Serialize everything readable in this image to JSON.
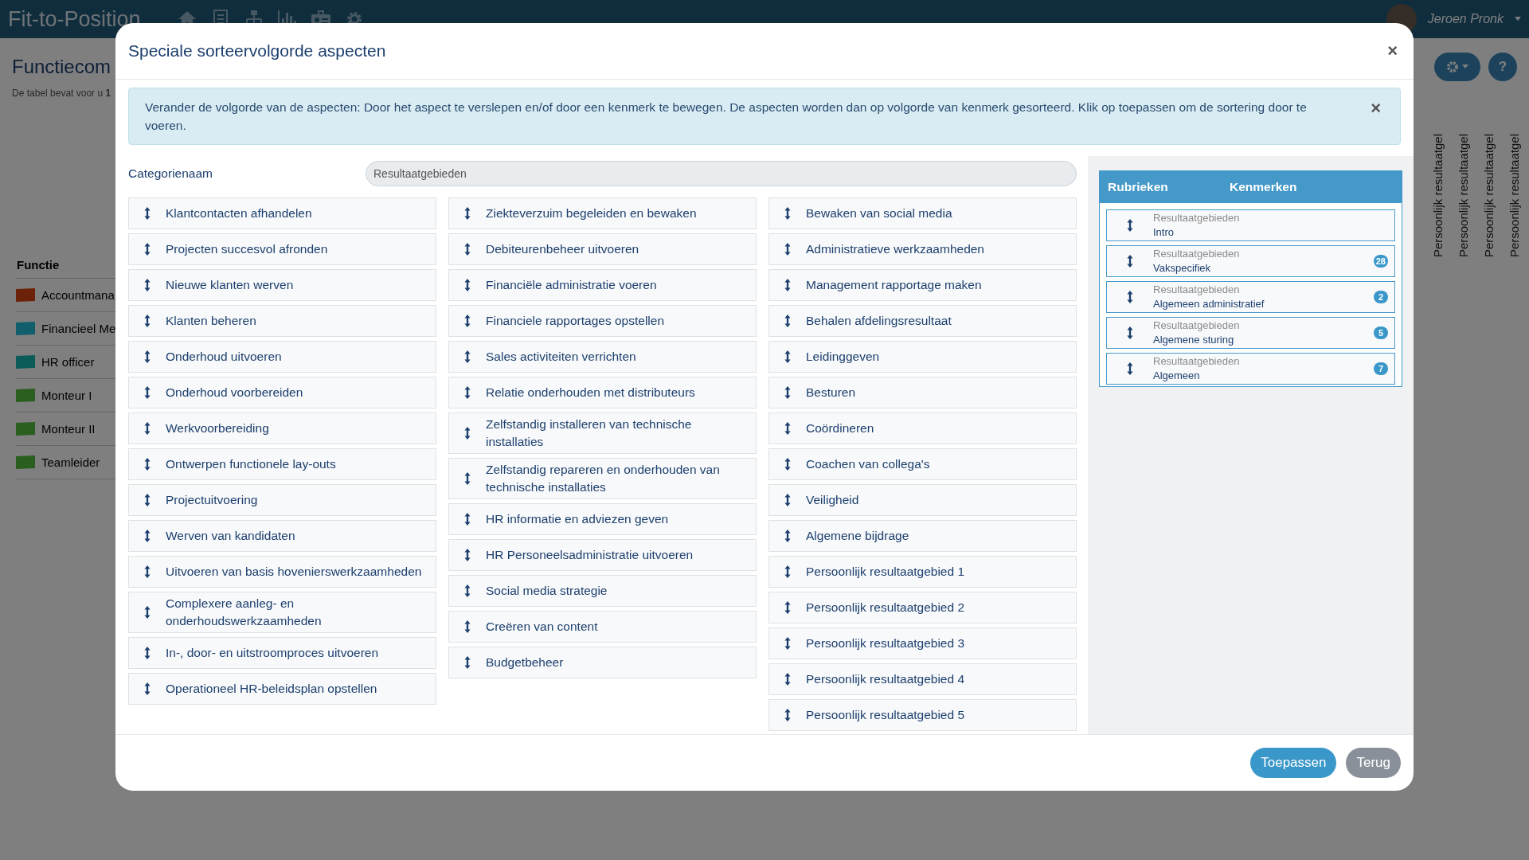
{
  "app": {
    "logo": "Fit-to-Position",
    "user": "Jeroen Pronk",
    "help": "?"
  },
  "page": {
    "title": "Functiecom",
    "summary": "De tabel bevat voor u **1**",
    "table": {
      "header": "Functie",
      "rows": [
        {
          "name": "Accountmana",
          "color": "#6b2208"
        },
        {
          "name": "Financieel Me",
          "color": "#115e6c"
        },
        {
          "name": "HR officer",
          "color": "#0b5c58"
        },
        {
          "name": "Monteur I",
          "color": "#2a5e1e"
        },
        {
          "name": "Monteur II",
          "color": "#2a5e1e"
        },
        {
          "name": "Teamleider",
          "color": "#2a5e1e"
        }
      ],
      "column_headers": [
        "Persoonlijk resultaatgel",
        "Persoonlijk resultaatgel",
        "Persoonlijk resultaatgel",
        "Persoonlijk resultaatgel"
      ]
    }
  },
  "modal": {
    "title": "Speciale sorteervolgorde aspecten",
    "close": "×",
    "alert": {
      "text": "Verander de volgorde van de aspecten: Door het aspect te verslepen en/of door een kenmerk te bewegen. De aspecten worden dan op volgorde van kenmerk gesorteerd. Klik op toepassen om de sortering door te voeren.",
      "close": "×"
    },
    "category": {
      "label": "Categorienaam",
      "value": "Resultaatgebieden"
    },
    "columns": [
      [
        "Klantcontacten afhandelen",
        "Projecten succesvol afronden",
        "Nieuwe klanten werven",
        "Klanten beheren",
        "Onderhoud uitvoeren",
        "Onderhoud voorbereiden",
        "Werkvoorbereiding",
        "Ontwerpen functionele lay-outs",
        "Projectuitvoering",
        "Werven van kandidaten",
        "Uitvoeren van basis hovenierswerkzaamheden",
        "Complexere aanleg- en onderhoudswerkzaamheden",
        "In-, door- en uitstroomproces uitvoeren",
        "Operationeel HR-beleidsplan opstellen"
      ],
      [
        "Ziekteverzuim begeleiden en bewaken",
        "Debiteurenbeheer uitvoeren",
        "Financiële administratie voeren",
        "Financiele rapportages opstellen",
        "Sales activiteiten verrichten",
        "Relatie onderhouden met distributeurs",
        "Zelfstandig installeren van technische installaties",
        "Zelfstandig repareren en onderhouden van technische installaties",
        "HR informatie en adviezen geven",
        "HR Personeelsadministratie uitvoeren",
        "Social media strategie",
        "Creëren van content",
        "Budgetbeheer"
      ],
      [
        "Bewaken van social media",
        "Administratieve werkzaamheden",
        "Management rapportage maken",
        "Behalen afdelingsresultaat",
        "Leidinggeven",
        "Besturen",
        "Coördineren",
        "Coachen van collega's",
        "Veiligheid",
        "Algemene bijdrage",
        "Persoonlijk resultaatgebied 1",
        "Persoonlijk resultaatgebied 2",
        "Persoonlijk resultaatgebied 3",
        "Persoonlijk resultaatgebied 4",
        "Persoonlijk resultaatgebied 5"
      ]
    ],
    "panel": {
      "headers": [
        "Rubrieken",
        "Kenmerken"
      ],
      "items": [
        {
          "category": "Resultaatgebieden",
          "name": "Intro"
        },
        {
          "category": "Resultaatgebieden",
          "name": "Vakspecifiek",
          "count": "28"
        },
        {
          "category": "Resultaatgebieden",
          "name": "Algemeen administratief",
          "count": "2"
        },
        {
          "category": "Resultaatgebieden",
          "name": "Algemene sturing",
          "count": "5"
        },
        {
          "category": "Resultaatgebieden",
          "name": "Algemeen",
          "count": "7"
        }
      ]
    },
    "buttons": [
      {
        "label": "Toepassen",
        "kind": "primary"
      },
      {
        "label": "Terug",
        "kind": "secondary"
      }
    ]
  }
}
